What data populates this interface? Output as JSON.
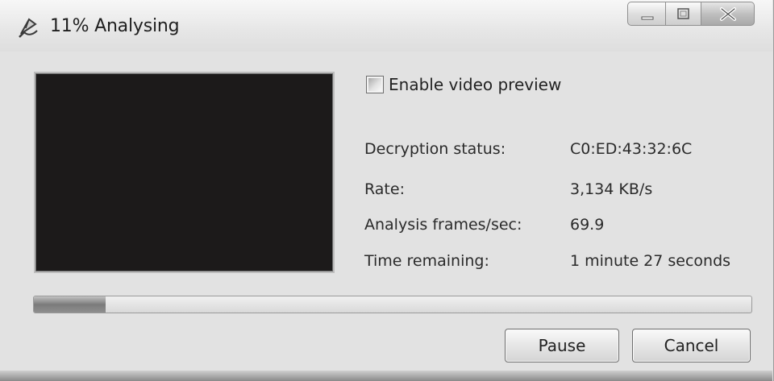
{
  "window": {
    "title": "11% Analysing",
    "app_icon": "satellite-dish-icon",
    "caption_buttons": [
      "minimize-icon",
      "maximize-icon",
      "close-icon"
    ]
  },
  "preview": {
    "checkbox_label": "Enable video preview",
    "checked": false
  },
  "stats": [
    {
      "label": "Decryption status:",
      "value": "C0:ED:43:32:6C"
    },
    {
      "label": "Rate:",
      "value": "3,134 KB/s"
    },
    {
      "label": "Analysis frames/sec:",
      "value": "69.9"
    },
    {
      "label": "Time remaining:",
      "value": "1 minute 27 seconds"
    }
  ],
  "progress": {
    "fraction": 0.1
  },
  "buttons": {
    "pause": "Pause",
    "cancel": "Cancel"
  }
}
